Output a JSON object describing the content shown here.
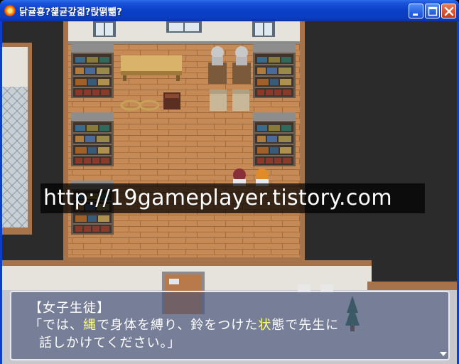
{
  "window": {
    "title": "닭귤횽?첉귣갚겗?랁뗡뺆?",
    "icon": "app-icon",
    "buttons": [
      "minimize-icon",
      "maximize-icon",
      "close-icon"
    ],
    "colors": {
      "titlebar": "#0a3fc7",
      "close": "#d9502a"
    }
  },
  "watermark": {
    "text": "http://19gameplayer.tistory.com"
  },
  "message": {
    "speaker": "【女子生徒】",
    "line1_a": "「では、",
    "line1_b": "縄",
    "line1_c": "で身体を縛り、鈴をつけた",
    "line1_d": "状",
    "line1_e": "態で先生に",
    "line2": "話しかけてください。」",
    "highlight_color": "#ffff80",
    "pause_indicator": "down-arrow-icon"
  }
}
